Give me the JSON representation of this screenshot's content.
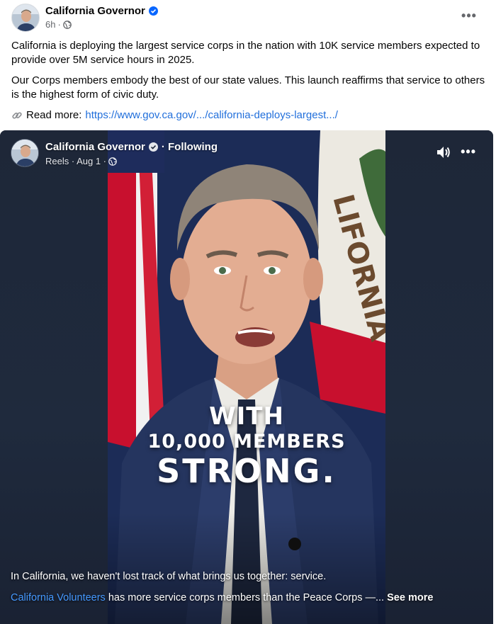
{
  "post": {
    "author": "California Governor",
    "time": "6h",
    "more_label": "•••",
    "paragraph1": "California is deploying the largest service corps in the nation with 10K service members expected to provide over 5M service hours in 2025.",
    "paragraph2": "Our Corps members embody the best of our state values. This launch reaffirms that service to others is the highest form of civic duty.",
    "read_more_label": "Read more:",
    "read_more_link": "https://www.gov.ca.gov/.../california-deploys-largest.../"
  },
  "reel": {
    "author": "California Governor",
    "following": "· Following",
    "source": "Reels · Aug 1 ·",
    "more_label": "•••",
    "video_text": {
      "line1": "WITH",
      "line2": "10,000 MEMBERS",
      "line3": "STRONG."
    },
    "caption": {
      "line1": "In California, we haven't lost track of what brings us together: service.",
      "link_text": "California Volunteers",
      "line2": " has more service corps members than the Peace Corps —...",
      "see_more": " See more"
    }
  },
  "colors": {
    "link": "#216fdb",
    "verified": "#0866ff",
    "reel_bg": "#1c2536",
    "caption_link": "#4599ff"
  },
  "icons": [
    "verified-badge-icon",
    "globe-icon",
    "more-options-icon",
    "link-icon",
    "sound-icon"
  ]
}
